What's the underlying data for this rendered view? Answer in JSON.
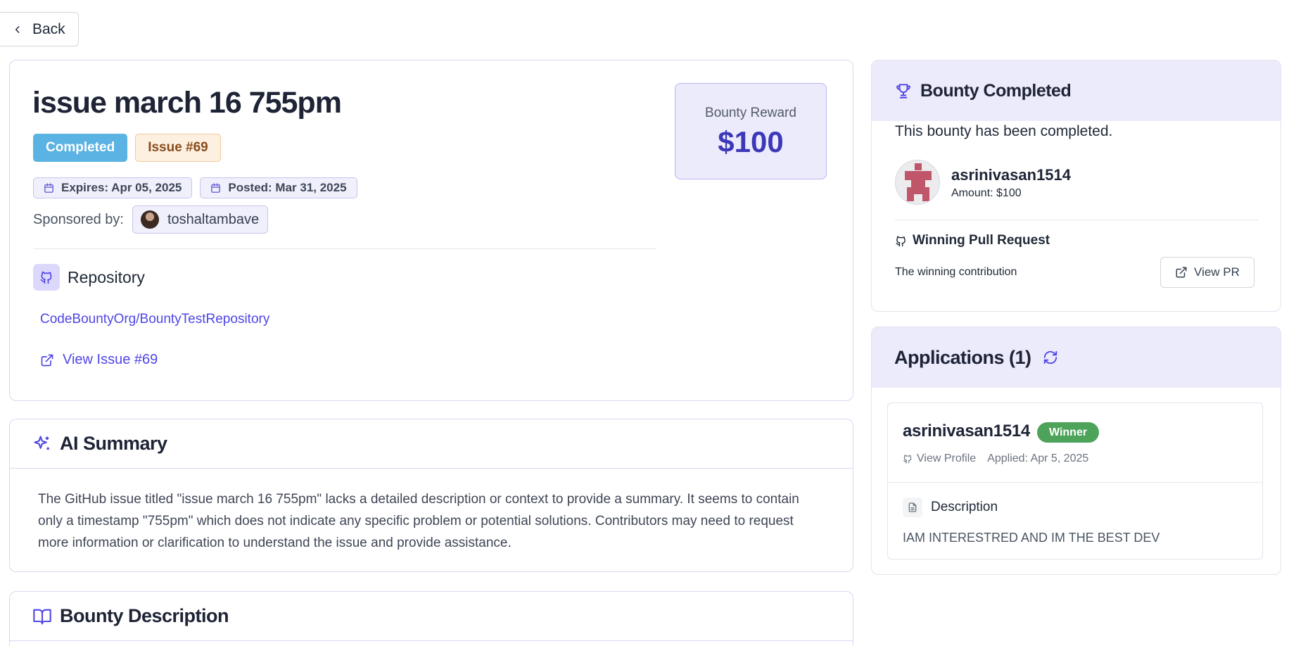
{
  "nav": {
    "back_label": "Back"
  },
  "issue": {
    "title": "issue march 16 755pm",
    "status_badge": "Completed",
    "issue_badge": "Issue #69",
    "expires": "Expires: Apr 05, 2025",
    "posted": "Posted: Mar 31, 2025",
    "sponsor_label": "Sponsored by:",
    "sponsor_name": "toshaltambave",
    "repository_title": "Repository",
    "repository_link": "CodeBountyOrg/BountyTestRepository",
    "view_issue_label": "View Issue #69"
  },
  "reward": {
    "label": "Bounty Reward",
    "value": "$100"
  },
  "ai_summary": {
    "title": "AI Summary",
    "text": "The GitHub issue titled \"issue march 16 755pm\" lacks a detailed description or context to provide a summary. It seems to contain only a timestamp \"755pm\" which does not indicate any specific problem or potential solutions. Contributors may need to request more information or clarification to understand the issue and provide assistance."
  },
  "bounty_description": {
    "title": "Bounty Description"
  },
  "completed": {
    "title": "Bounty Completed",
    "message": "This bounty has been completed.",
    "winner_name": "asrinivasan1514",
    "winner_amount": "Amount: $100",
    "pr_title": "Winning Pull Request",
    "pr_text": "The winning contribution",
    "view_pr_label": "View PR"
  },
  "applications": {
    "title": "Applications (1)",
    "items": [
      {
        "name": "asrinivasan1514",
        "badge": "Winner",
        "view_profile": "View Profile",
        "applied": "Applied: Apr 5, 2025",
        "description_title": "Description",
        "description_text": "IAM INTERESTRED AND IM THE BEST DEV"
      }
    ]
  },
  "colors": {
    "accent": "#4f46e5",
    "completed_badge": "#5bb3e3",
    "winner_badge": "#4da35a",
    "reward_value": "#3d38b8"
  },
  "icons": [
    "chevron-left-icon",
    "calendar-icon",
    "github-icon",
    "external-link-icon",
    "sparkles-icon",
    "book-open-icon",
    "trophy-icon",
    "refresh-icon",
    "document-icon"
  ]
}
